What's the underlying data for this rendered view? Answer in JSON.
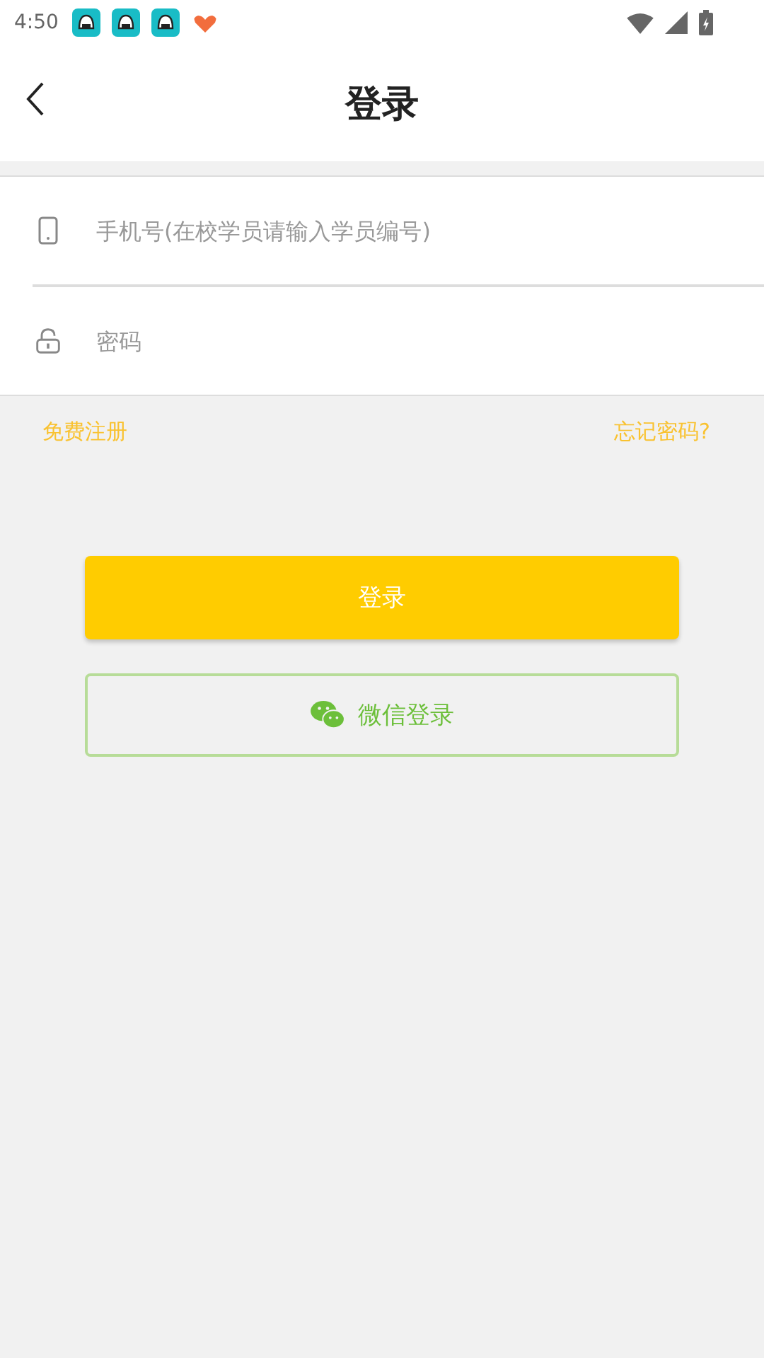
{
  "status_bar": {
    "time": "4:50"
  },
  "header": {
    "title": "登录"
  },
  "fields": [
    {
      "kind": "phone",
      "placeholder": "手机号(在校学员请输入学员编号)"
    },
    {
      "kind": "password",
      "placeholder": "密码"
    }
  ],
  "links": {
    "register": "免费注册",
    "forgot": "忘记密码?"
  },
  "login_button": "登录",
  "wechat_button": "微信登录"
}
